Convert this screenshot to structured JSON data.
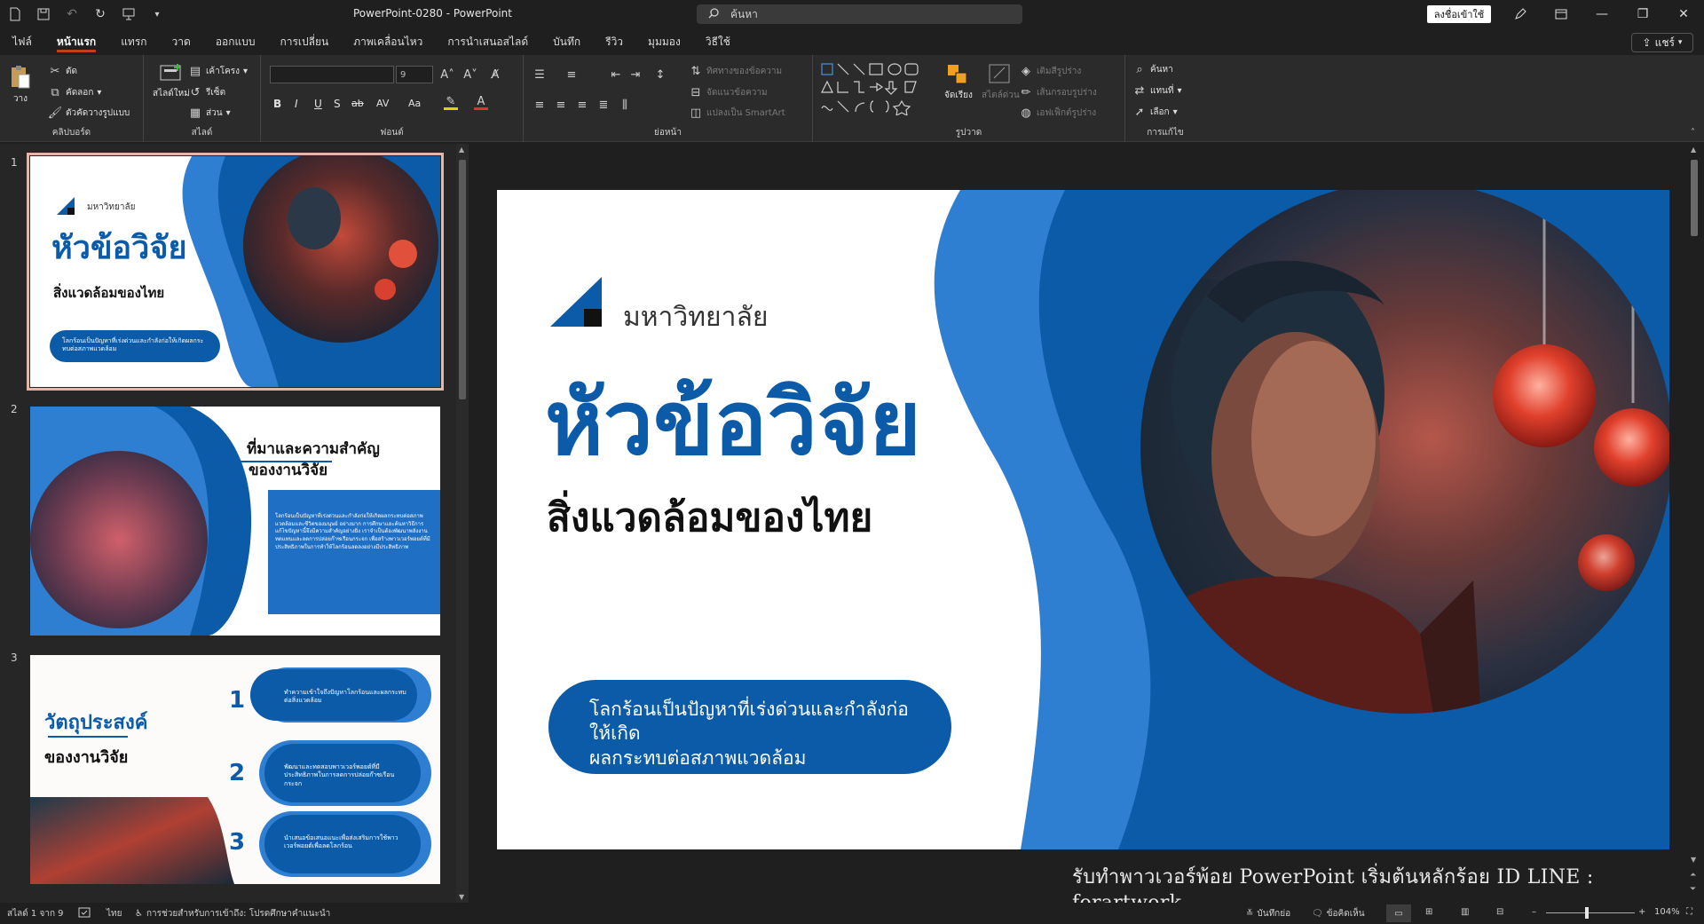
{
  "window": {
    "title": "PowerPoint-0280  -  PowerPoint",
    "search_placeholder": "ค้นหา",
    "signin_label": "ลงชื่อเข้าใช้"
  },
  "tabs": [
    "ไฟล์",
    "หน้าแรก",
    "แทรก",
    "วาด",
    "ออกแบบ",
    "การเปลี่ยน",
    "ภาพเคลื่อนไหว",
    "การนำเสนอสไลด์",
    "บันทึก",
    "รีวิว",
    "มุมมอง",
    "วิธีใช้"
  ],
  "share_label": "แชร์",
  "ribbon": {
    "clipboard": {
      "label": "คลิปบอร์ด",
      "paste": "วาง",
      "cut": "ตัด",
      "copy": "คัดลอก",
      "format_painter": "ตัวคัดวางรูปแบบ"
    },
    "slides": {
      "label": "สไลด์",
      "new_slide": "สไลด์ใหม่",
      "layout": "เค้าโครง",
      "reset": "รีเซ็ต",
      "section": "ส่วน"
    },
    "font": {
      "label": "ฟอนต์",
      "size": "9",
      "bold": "B",
      "italic": "I",
      "underline": "U",
      "shadow": "S",
      "strike": "ab",
      "spacing": "AV",
      "case": "Aa"
    },
    "paragraph": {
      "label": "ย่อหน้า",
      "text_direction": "ทิศทางของข้อความ",
      "align_text": "จัดแนวข้อความ",
      "smartart": "แปลงเป็น SmartArt"
    },
    "drawing": {
      "label": "รูปวาด",
      "arrange": "จัดเรียง",
      "quick_styles": "สไตล์ด่วน",
      "fill": "เติมสีรูปร่าง",
      "outline": "เส้นกรอบรูปร่าง",
      "effects": "เอฟเฟ็กต์รูปร่าง"
    },
    "editing": {
      "label": "การแก้ไข",
      "find": "ค้นหา",
      "replace": "แทนที่",
      "select": "เลือก"
    }
  },
  "thumbnails": [
    {
      "num": "1",
      "logo": "มหาวิทยาลัย",
      "title": "หัวข้อวิจัย",
      "subtitle": "สิ่งแวดล้อมของไทย",
      "pill": "โลกร้อนเป็นปัญหาที่เร่งด่วนและกำลังก่อให้เกิดผลกระทบต่อสภาพแวดล้อม"
    },
    {
      "num": "2",
      "title_line1": "ที่มาและความสำคัญ",
      "title_line2": "ของงานวิจัย",
      "body": "โลกร้อนเป็นปัญหาที่เร่งด่วนและกำลังก่อให้เกิดผลกระทบต่อสภาพแวดล้อมและชีวิตของมนุษย์ อย่างมาก การศึกษาและค้นหาวิธีการแก้ไขปัญหานี้จึงมีความสำคัญอย่างยิ่ง เราจำเป็นต้องพัฒนาพลังงานทดแทนและลดการปล่อยก๊าซเรือนกระจก เพื่อสร้างพาวเวอร์พอยต์ที่มีประสิทธิภาพในการทำให้โลกร้อนลดลงอย่างมีประสิทธิภาพ"
    },
    {
      "num": "3",
      "title_line1": "วัตถุประสงค์",
      "title_line2": "ของงานวิจัย",
      "items": [
        {
          "n": "1",
          "text": "ทำความเข้าใจถึงปัญหาโลกร้อนและผลกระทบต่อสิ่งแวดล้อม"
        },
        {
          "n": "2",
          "text": "พัฒนาและทดสอบพาวเวอร์พอยต์ที่มีประสิทธิภาพในการลดการปล่อยก๊าซเรือนกระจก"
        },
        {
          "n": "3",
          "text": "นำเสนอข้อเสนอแนะเพื่อส่งเสริมการใช้พาวเวอร์พอยต์เพื่อลดโลกร้อน"
        }
      ]
    }
  ],
  "slide": {
    "logo_text": "มหาวิทยาลัย",
    "title": "หัวข้อวิจัย",
    "subtitle": "สิ่งแวดล้อมของไทย",
    "pill_line1": "โลกร้อนเป็นปัญหาที่เร่งด่วนและกำลังก่อให้เกิด",
    "pill_line2": "ผลกระทบต่อสภาพแวดล้อม"
  },
  "promo_text": "รับทำพาวเวอร์พ้อย PowerPoint เริ่มต้นหลักร้อย ID LINE : forartwork",
  "status": {
    "slide_pos": "สไลด์ 1 จาก 9",
    "language": "ไทย",
    "accessibility": "การช่วยสำหรับการเข้าถึง: โปรดศึกษาคำแนะนำ",
    "notes": "บันทึกย่อ",
    "comments": "ข้อคิดเห็น",
    "zoom": "104%"
  },
  "colors": {
    "brand_blue": "#0b5ba8",
    "brand_light": "#2e7ed1",
    "accent_tab": "#c43e1c"
  }
}
